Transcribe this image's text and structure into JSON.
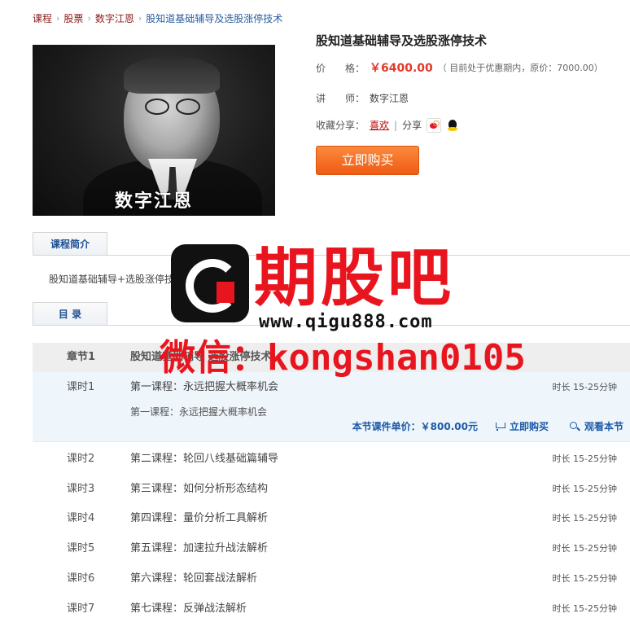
{
  "breadcrumb": {
    "items": [
      "课程",
      "股票",
      "数字江恩",
      "股知道基础辅导及选股涨停技术"
    ],
    "separator": "›"
  },
  "cover": {
    "name_text": "数字江恩"
  },
  "product": {
    "title": "股知道基础辅导及选股涨停技术",
    "price_label": "价　　格：",
    "price": "￥6400.00",
    "price_note": "（ 目前处于优惠期内，原价：7000.00）",
    "teacher_label": "讲　　师：",
    "teacher": "数字江恩",
    "share_label": "收藏分享：",
    "like_label": "喜欢",
    "share_text": "分享",
    "buy_label": "立即购买"
  },
  "intro": {
    "tab_label": "课程简介",
    "text": "股知道基础辅导+选股涨停技"
  },
  "syllabus": {
    "tab_label": "目 录",
    "chapter": {
      "num": "章节1",
      "title": "股知道基础辅导 选股涨停技术"
    },
    "expanded": {
      "num": "课时1",
      "title": "第一课程：永远把握大概率机会",
      "duration": "时长 15-25分钟",
      "subtitle": "第一课程：永远把握大概率机会",
      "unit_price": "本节课件单价：￥800.00元",
      "buy_label": "立即购买",
      "view_label": "观看本节"
    },
    "lessons": [
      {
        "num": "课时2",
        "title": "第二课程：轮回八线基础篇辅导",
        "duration": "时长 15-25分钟"
      },
      {
        "num": "课时3",
        "title": "第三课程：如何分析形态结构",
        "duration": "时长 15-25分钟"
      },
      {
        "num": "课时4",
        "title": "第四课程：量价分析工具解析",
        "duration": "时长 15-25分钟"
      },
      {
        "num": "课时5",
        "title": "第五课程：加速拉升战法解析",
        "duration": "时长 15-25分钟"
      },
      {
        "num": "课时6",
        "title": "第六课程：轮回套战法解析",
        "duration": "时长 15-25分钟"
      },
      {
        "num": "课时7",
        "title": "第七课程：反弹战法解析",
        "duration": "时长 15-25分钟"
      }
    ]
  },
  "watermark": {
    "brand": "期股吧",
    "url": "www.qigu888.com",
    "wechat": "微信：kongshan0105"
  },
  "colors": {
    "accent_red": "#e4392b",
    "link_blue": "#1d5aa8",
    "buy_orange": "#ef5b14",
    "watermark_red": "#e8151f"
  }
}
